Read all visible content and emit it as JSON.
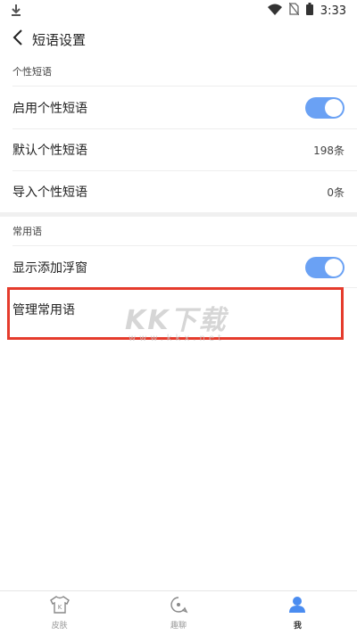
{
  "status_bar": {
    "time": "3:33"
  },
  "nav": {
    "title": "短语设置"
  },
  "sections": [
    {
      "header": "个性短语",
      "rows": [
        {
          "label": "启用个性短语",
          "toggle": true
        },
        {
          "label": "默认个性短语",
          "value": "198条"
        },
        {
          "label": "导入个性短语",
          "value": "0条"
        }
      ]
    },
    {
      "header": "常用语",
      "rows": [
        {
          "label": "显示添加浮窗",
          "toggle": true
        },
        {
          "label": "管理常用语"
        }
      ]
    }
  ],
  "watermark": {
    "main": "KK下载",
    "sub": "www.kkx.net"
  },
  "tabs": [
    {
      "label": "皮肤",
      "icon": "shirt-icon"
    },
    {
      "label": "趣聊",
      "icon": "chat-icon"
    },
    {
      "label": "我",
      "icon": "person-icon",
      "active": true
    }
  ],
  "colors": {
    "accent": "#6aa1f4",
    "highlight": "#e53b2c"
  }
}
